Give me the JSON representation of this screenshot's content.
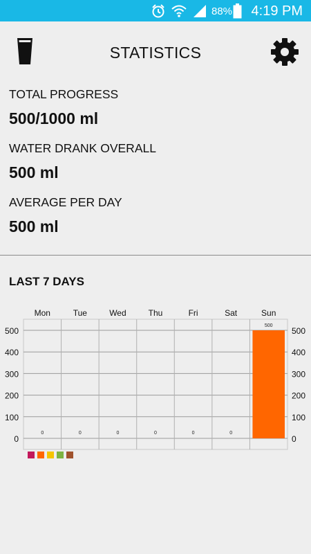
{
  "status_bar": {
    "battery_percent": "88%",
    "time": "4:19 PM",
    "background": "#19b8e6"
  },
  "app_bar": {
    "title": "STATISTICS",
    "left_icon": "glass-icon",
    "right_icon": "gear-icon"
  },
  "stats": {
    "total_progress_label": "TOTAL PROGRESS",
    "total_progress_value": "500/1000 ml",
    "water_drank_label": "WATER DRANK OVERALL",
    "water_drank_value": "500 ml",
    "average_label": "AVERAGE PER DAY",
    "average_value": "500 ml"
  },
  "last_days": {
    "title": "LAST 7 DAYS"
  },
  "chart_data": {
    "type": "bar",
    "categories": [
      "Mon",
      "Tue",
      "Wed",
      "Thu",
      "Fri",
      "Sat",
      "Sun"
    ],
    "values": [
      0,
      0,
      0,
      0,
      0,
      0,
      500
    ],
    "data_labels": [
      "0",
      "0",
      "0",
      "0",
      "0",
      "0",
      "500"
    ],
    "yticks": [
      "0",
      "100",
      "200",
      "300",
      "400",
      "500"
    ],
    "ylim": [
      0,
      500
    ],
    "grid": true,
    "bar_color": "#ff6600",
    "legend_colors": [
      "#c2185b",
      "#ff6600",
      "#f5c400",
      "#7cb342",
      "#a0522d"
    ]
  }
}
